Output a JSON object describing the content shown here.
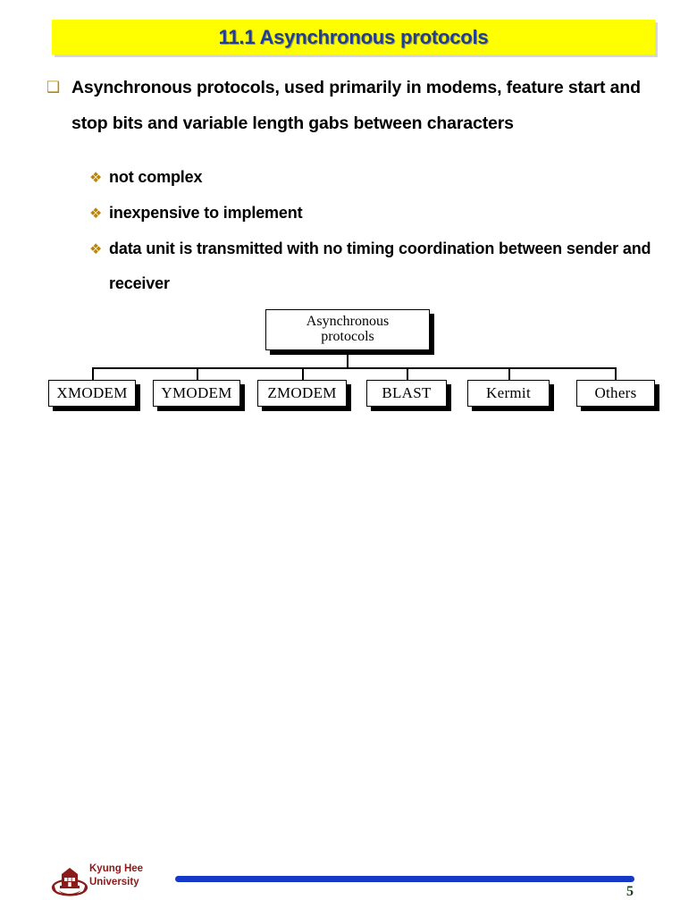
{
  "slide": {
    "title": "11.1 Asynchronous protocols",
    "title_bg_color": "#ffff00",
    "title_text_color": "#1f3d99"
  },
  "bullets": {
    "bullet_level1_glyph": "❑",
    "bullet_level2_glyph": "❖",
    "bullet_color": "#b8860b",
    "items": [
      {
        "level": 1,
        "text": "Asynchronous protocols, used primarily in modems, feature start and stop bits and variable length gabs between characters"
      },
      {
        "level": 2,
        "text": "not complex"
      },
      {
        "level": 2,
        "text": "inexpensive to implement"
      },
      {
        "level": 2,
        "text": "data unit is transmitted with no timing coordination between sender and receiver"
      }
    ]
  },
  "diagram": {
    "root": "Asynchronous\nprotocols",
    "leaves": [
      "XMODEM",
      "YMODEM",
      "ZMODEM",
      "BLAST",
      "Kermit",
      "Others"
    ]
  },
  "footer": {
    "organization": "Kyung Hee\nUniversity",
    "organization_color": "#8b1a1a",
    "bar_color": "#1438c8",
    "page_number": "5"
  }
}
